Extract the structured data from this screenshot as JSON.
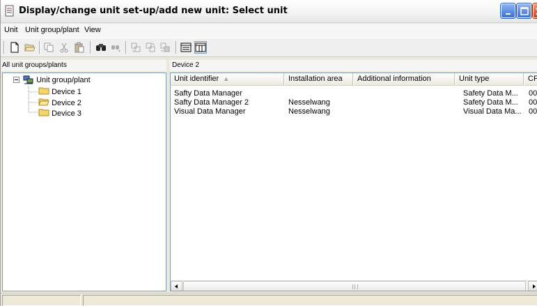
{
  "window": {
    "title": "Display/change unit set-up/add new unit: Select unit",
    "controls": [
      "minimize",
      "maximize",
      "close"
    ]
  },
  "menu": [
    "Unit",
    "Unit group/plant",
    "View"
  ],
  "toolbar": {
    "icons": [
      "new-icon",
      "open-icon",
      "copy-icon",
      "cut-icon",
      "paste-icon",
      "find-icon",
      "find-next-icon",
      "unit-1-icon",
      "unit-2-icon",
      "unit-3-icon",
      "details-view-icon",
      "list-view-icon"
    ]
  },
  "left_panel": {
    "header": "All unit groups/plants",
    "tree": {
      "root": "Unit group/plant",
      "children": [
        "Device 1",
        "Device 2",
        "Device 3"
      ],
      "selected": "Device 2"
    }
  },
  "right_panel": {
    "header": "Device 2",
    "columns": [
      "Unit identifier",
      "Installation area",
      "Additional information",
      "Unit type",
      "CPU"
    ],
    "sorted_column": "Unit identifier",
    "rows": [
      [
        "Safty Data Manager",
        "",
        "",
        "Safety Data M...",
        "00"
      ],
      [
        "Safty Data Manager 2",
        "Nesselwang",
        "",
        "Safety Data M...",
        "00"
      ],
      [
        "Visual Data Manager",
        "Nesselwang",
        "",
        "Visual Data Ma...",
        "00"
      ]
    ]
  },
  "colors": {
    "folder": "#f6d66a",
    "title_buttons": "#3a6fd8",
    "close_button": "#d23c14",
    "border": "#7f9db9"
  }
}
